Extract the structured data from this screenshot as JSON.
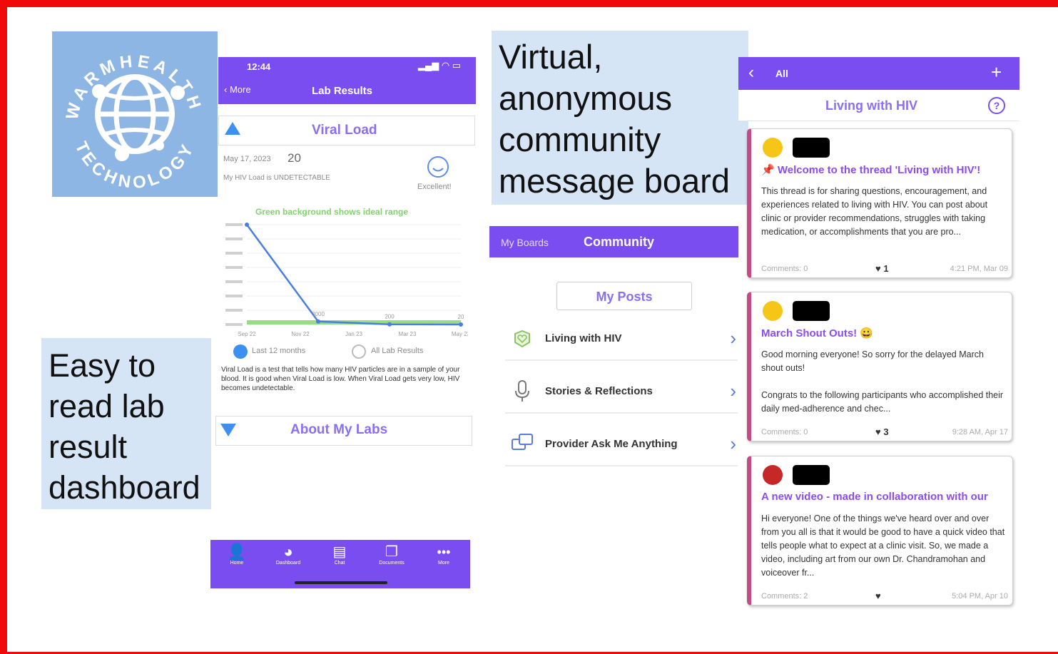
{
  "captions": {
    "lab": "Easy to read lab result dashboard",
    "community": "Virtual, anonymous community message board"
  },
  "logo": {
    "text": "WARMHEALTH TECHNOLOGY",
    "icon": "globe-network-icon"
  },
  "lab_app": {
    "status_time": "12:44",
    "back_label": "More",
    "title": "Lab Results",
    "section_viral": "Viral Load",
    "date": "May 17, 2023",
    "value": "20",
    "status_text": "My HIV Load is UNDETECTABLE",
    "rating": "Excellent!",
    "chart_note": "Green background shows ideal range",
    "legend_last": "Last 12 months",
    "legend_all": "All Lab Results",
    "description": "Viral Load is a test that tells how many HIV particles are in a sample of your blood. It is good when Viral Load is low. When Viral Load gets very low, HIV becomes undetectable.",
    "section_about": "About My Labs",
    "tabs": [
      "Home",
      "Dashboard",
      "Chat",
      "Documents",
      "More"
    ]
  },
  "chart_data": {
    "type": "line",
    "x": [
      "Sep 22",
      "Nov 22",
      "Jan 23",
      "Mar 23",
      "May 23"
    ],
    "values": [
      100000,
      3000,
      200,
      20
    ],
    "data_labels": [
      "",
      "3000",
      "200",
      "20"
    ],
    "ylim": [
      0,
      100000
    ],
    "grid": true,
    "title": "",
    "xlabel": "",
    "ylabel": "",
    "line_color": "#4a7ee0",
    "ideal_range_color": "#7fd36a"
  },
  "community_app": {
    "tab_my_boards": "My Boards",
    "tab_community": "Community",
    "my_posts": "My Posts",
    "boards": [
      {
        "label": "Living with HIV",
        "icon": "heart-hands-icon"
      },
      {
        "label": "Stories & Reflections",
        "icon": "microphone-icon"
      },
      {
        "label": "Provider Ask Me Anything",
        "icon": "chat-bubbles-icon"
      }
    ]
  },
  "thread_app": {
    "back_label": "All",
    "add_icon": "plus-icon",
    "title": "Living with HIV",
    "help_icon": "question-circle-icon",
    "posts": [
      {
        "emoji": "smiley-face-icon",
        "title": "📌 Welcome to the thread 'Living with HIV'!",
        "body": "This thread is for sharing questions, encouragement, and experiences related to living with HIV. You can post about clinic or provider recommendations, struggles with taking medication, or accomplishments that you are pro...",
        "comments": "Comments: 0",
        "likes": "1",
        "time": "4:21 PM, Mar 09"
      },
      {
        "emoji": "smiley-face-icon",
        "title": "March Shout Outs! 😀",
        "body": "Good morning everyone! So sorry for the delayed March shout outs!\n\nCongrats to the following participants who accomplished their daily med-adherence and chec...",
        "comments": "Comments: 0",
        "likes": "3",
        "time": "9:28 AM, Apr 17"
      },
      {
        "emoji": "ladybug-icon",
        "title": "A new video - made in collaboration with our",
        "body": "Hi everyone! One of the things we've heard over and over from you all is that it would be good to have a quick video that tells people what to expect at a clinic visit. So, we made a video, including art from our own Dr. Chandramohan and voiceover fr...",
        "comments": "Comments: 2",
        "likes": "",
        "time": "5:04 PM, Apr 10"
      }
    ]
  },
  "colors": {
    "accent": "#7a4df0",
    "caption_bg": "#d6e5f5",
    "logo_bg": "#8db6e4",
    "frame": "#f10a0a",
    "post_stripe": "#c54b86"
  }
}
